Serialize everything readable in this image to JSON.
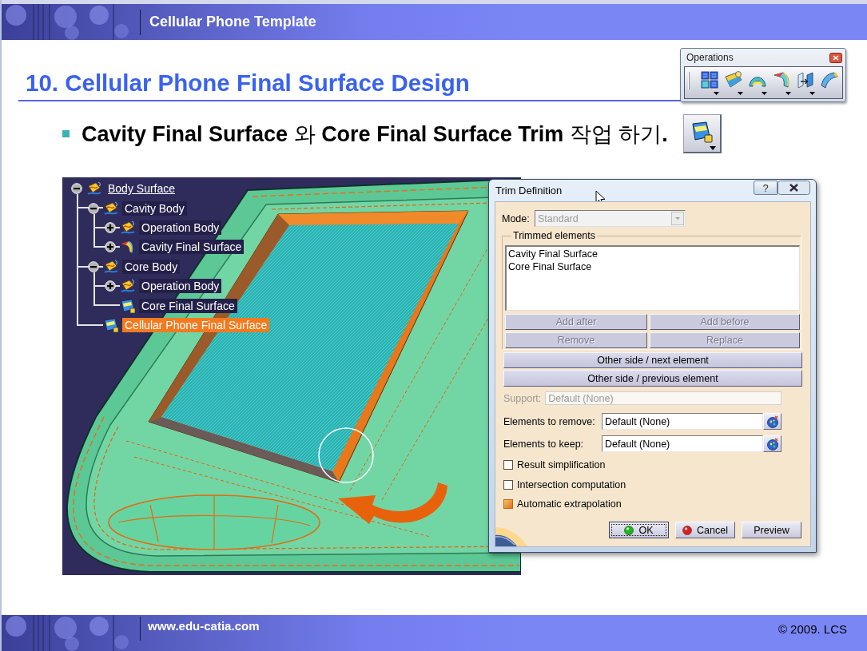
{
  "header": {
    "title": "Cellular Phone Template"
  },
  "slide_title": "10. Cellular Phone Final Surface Design",
  "operations_toolbar": {
    "title": "Operations",
    "tools": [
      {
        "dropdown": true
      },
      {
        "dropdown": true
      },
      {
        "dropdown": true
      },
      {
        "dropdown": true
      },
      {
        "dropdown": true
      },
      {
        "dropdown": false
      }
    ]
  },
  "bullet": {
    "text": "**Cavity Final Surface** 와 **Core Final Surface Trim** 작업 하기**.**",
    "tool": {
      "dropdown": true
    }
  },
  "model_view": {
    "tree": [
      {
        "label": "Body Surface",
        "kind": "body",
        "expandable": true,
        "expanded": true,
        "in_work": true,
        "selected": false,
        "children": [
          {
            "label": "Cavity Body",
            "kind": "body",
            "expandable": true,
            "expanded": true,
            "in_work": false,
            "selected": false,
            "children": [
              {
                "label": "Operation Body",
                "kind": "body",
                "expandable": true,
                "expanded": false,
                "in_work": false,
                "selected": false
              },
              {
                "label": "Cavity Final Surface",
                "kind": "surface",
                "expandable": true,
                "expanded": false,
                "in_work": false,
                "selected": false
              }
            ]
          },
          {
            "label": "Core Body",
            "kind": "body",
            "expandable": true,
            "expanded": true,
            "in_work": false,
            "selected": false,
            "children": [
              {
                "label": "Operation Body",
                "kind": "body",
                "expandable": true,
                "expanded": false,
                "in_work": false,
                "selected": false
              },
              {
                "label": "Core Final Surface",
                "kind": "trim",
                "expandable": false,
                "in_work": false,
                "selected": false
              }
            ]
          },
          {
            "label": "Cellular Phone Final Surface",
            "kind": "trim",
            "expandable": false,
            "in_work": false,
            "selected": true
          }
        ]
      }
    ]
  },
  "trim_dialog": {
    "title": "Trim Definition",
    "help_button": "?",
    "mode": {
      "label": "Mode:",
      "value": "Standard",
      "disabled": true
    },
    "trimmed_elements": {
      "legend": "Trimmed elements",
      "items": [
        "Cavity Final Surface",
        "Core Final Surface"
      ],
      "buttons": [
        {
          "label": "Add after",
          "disabled": true
        },
        {
          "label": "Add before",
          "disabled": true
        },
        {
          "label": "Remove",
          "disabled": true
        },
        {
          "label": "Replace",
          "disabled": true
        }
      ]
    },
    "side_buttons": [
      {
        "label": "Other side / next element",
        "disabled": false
      },
      {
        "label": "Other side / previous element",
        "disabled": false
      }
    ],
    "fields": [
      {
        "label": "Support:",
        "value": "Default (None)",
        "disabled": true,
        "picker": false
      },
      {
        "label": "Elements to remove:",
        "value": "Default (None)",
        "disabled": false,
        "picker": true
      },
      {
        "label": "Elements to keep:",
        "value": "Default (None)",
        "disabled": false,
        "picker": true
      }
    ],
    "options": [
      {
        "label": "Result simplification",
        "checked": false
      },
      {
        "label": "Intersection computation",
        "checked": false
      },
      {
        "label": "Automatic extrapolation",
        "checked": true
      }
    ],
    "actions": [
      {
        "label": "OK",
        "kind": "ok",
        "focused": true
      },
      {
        "label": "Cancel",
        "kind": "cancel",
        "focused": false
      },
      {
        "label": "Preview",
        "kind": "plain",
        "focused": false
      }
    ]
  },
  "footer": {
    "website": "www.edu-catia.com",
    "copyright": "© 2009. LCS"
  }
}
